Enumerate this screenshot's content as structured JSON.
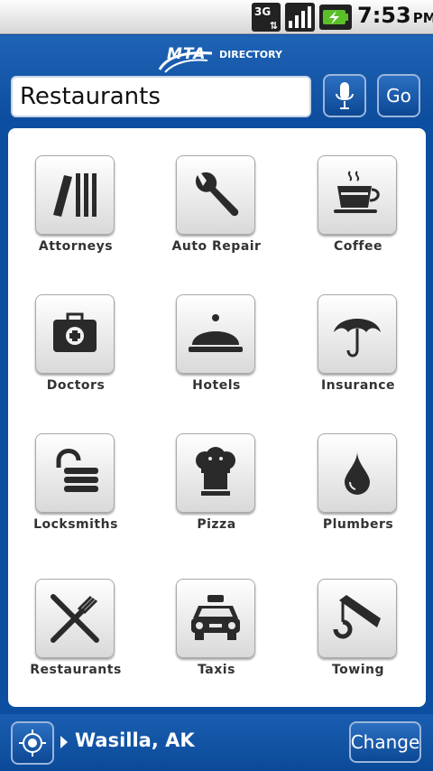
{
  "status_bar": {
    "network": "3G",
    "time": "7:53",
    "ampm": "PM"
  },
  "header": {
    "logo_brand": "MTA",
    "logo_product": "DIRECTORY",
    "search_value": "Restaurants",
    "go_label": "Go"
  },
  "categories": [
    {
      "label": "Attorneys",
      "icon": "books-icon"
    },
    {
      "label": "Auto Repair",
      "icon": "wrench-icon"
    },
    {
      "label": "Coffee",
      "icon": "coffee-cup-icon"
    },
    {
      "label": "Doctors",
      "icon": "medical-kit-icon"
    },
    {
      "label": "Hotels",
      "icon": "cloche-icon"
    },
    {
      "label": "Insurance",
      "icon": "umbrella-icon"
    },
    {
      "label": "Locksmiths",
      "icon": "padlock-icon"
    },
    {
      "label": "Pizza",
      "icon": "chef-hat-icon"
    },
    {
      "label": "Plumbers",
      "icon": "water-drop-icon"
    },
    {
      "label": "Restaurants",
      "icon": "knife-fork-icon"
    },
    {
      "label": "Taxis",
      "icon": "taxi-icon"
    },
    {
      "label": "Towing",
      "icon": "tow-hook-icon"
    }
  ],
  "footer": {
    "location": "Wasilla, AK",
    "change_label": "Change"
  },
  "colors": {
    "header_blue": "#0d4d9d",
    "icon_dark": "#2a2a2a"
  }
}
